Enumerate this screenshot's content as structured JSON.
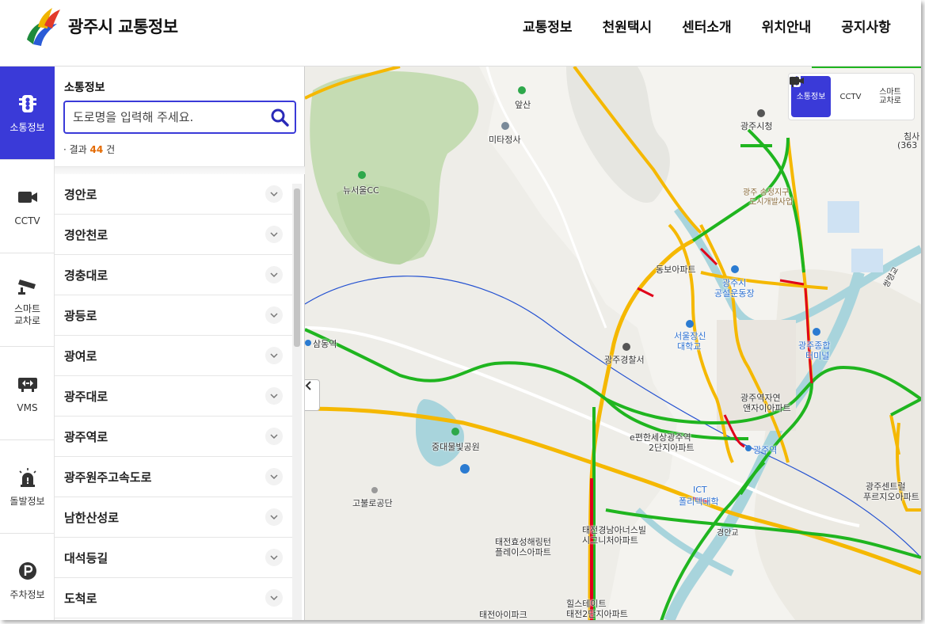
{
  "header": {
    "site_title": "광주시 교통정보",
    "nav": [
      "교통정보",
      "천원택시",
      "센터소개",
      "위치안내",
      "공지사항"
    ]
  },
  "sidebar": {
    "items": [
      {
        "label": "소통정보",
        "icon": "traffic-light-icon",
        "active": true
      },
      {
        "label": "CCTV",
        "icon": "cctv-icon",
        "active": false
      },
      {
        "label": "스마트\n교차로",
        "icon": "smart-camera-icon",
        "active": false
      },
      {
        "label": "VMS",
        "icon": "vms-sign-icon",
        "active": false
      },
      {
        "label": "돌발정보",
        "icon": "alert-siren-icon",
        "active": false
      },
      {
        "label": "주차정보",
        "icon": "parking-icon",
        "active": false
      }
    ]
  },
  "panel": {
    "title": "소통정보",
    "search_placeholder": "도로명을 입력해 주세요.",
    "result_prefix": "· 결과",
    "result_count": "44",
    "result_suffix": "건",
    "roads": [
      "경안로",
      "경안천로",
      "경충대로",
      "광등로",
      "광여로",
      "광주대로",
      "광주역로",
      "광주원주고속도로",
      "남한산성로",
      "대석등길",
      "도척로"
    ]
  },
  "map": {
    "layer_buttons": [
      {
        "label": "소통정보",
        "icon": "traffic-light-icon",
        "active": true
      },
      {
        "label": "CCTV",
        "icon": "cctv-icon",
        "active": false
      },
      {
        "label": "스마트\n교차로",
        "icon": "smart-camera-icon",
        "active": false
      }
    ],
    "labels": {
      "ssangsan": "앞산",
      "mitajeongsa": "미타정사",
      "newseoul": "뉴서울CC",
      "cityhall": "광주시청",
      "songjeong": "광주 송정지구",
      "songjeong2": "도시개발사업",
      "dongbo": "동보아파트",
      "sports": "광주시",
      "sports2": "공설운동장",
      "univ": "서울장신",
      "univ2": "대학교",
      "police": "광주경찰서",
      "terminal": "광주종합",
      "terminal2": "터미널",
      "station_apt": "광주역자연",
      "station_apt2": "앤자이아파트",
      "ecomfort": "e편한세상광주역",
      "ecomfort2": "2단지아파트",
      "station": "광주역",
      "ict": "ICT",
      "ict2": "폴리텍대학",
      "park": "중대물빛공원",
      "gobul": "고불로공단",
      "taejeon1": "태전효성해링턴",
      "taejeon1b": "플레이스아파트",
      "taejeon2": "태전경남아너스빌",
      "taejeon2b": "시그니처아파트",
      "taejeon3": "힐스테이트",
      "taejeon3b": "태전2단지아파트",
      "taejeon4": "태전아이파크",
      "centrale": "광주센트럴",
      "centrale2": "푸르지오아파트",
      "samdong": "삼동역",
      "chimsa": "침사",
      "chimsa_h": "(363",
      "gyeongan": "경안교",
      "ssangryeong": "쌍령교"
    }
  },
  "colors": {
    "accent": "#3a3ad8",
    "flow_good": "#1fb51f",
    "flow_slow": "#f5b800",
    "flow_jam": "#e0001a"
  }
}
